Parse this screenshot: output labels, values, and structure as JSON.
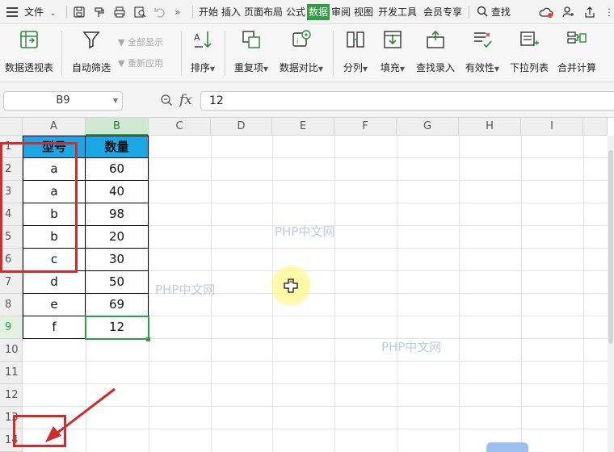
{
  "menubar": {
    "file_label": "文件",
    "tabs": [
      "开始",
      "插入",
      "页面布局",
      "公式",
      "数据",
      "审阅",
      "视图",
      "开发工具",
      "会员专享"
    ],
    "active_tab": "数据",
    "search_label": "查找"
  },
  "ribbon": {
    "pivot_label": "数据透视表",
    "autofilter_label": "自动筛选",
    "show_all_label": "全部显示",
    "reapply_label": "重新应用",
    "sort_label": "排序",
    "duplicates_label": "重复项",
    "compare_label": "数据对比",
    "split_label": "分列",
    "fill_label": "填充",
    "lookup_entry_label": "查找录入",
    "validity_label": "有效性",
    "dropdown_list_label": "下拉列表",
    "consolidate_label": "合并计算"
  },
  "formula_bar": {
    "name_box": "B9",
    "fx_label": "fx",
    "value": "12"
  },
  "sheet": {
    "columns": [
      "A",
      "B",
      "C",
      "D",
      "E",
      "F",
      "G",
      "H",
      "I"
    ],
    "rows": [
      "1",
      "2",
      "3",
      "4",
      "5",
      "6",
      "7",
      "8",
      "9",
      "10",
      "11",
      "12",
      "13",
      "14"
    ],
    "selected_column": "B",
    "selected_row": "9",
    "header_row": [
      "型号",
      "数量"
    ],
    "data": [
      [
        "a",
        "60"
      ],
      [
        "a",
        "40"
      ],
      [
        "b",
        "98"
      ],
      [
        "b",
        "20"
      ],
      [
        "c",
        "30"
      ],
      [
        "d",
        "50"
      ],
      [
        "e",
        "69"
      ],
      [
        "f",
        "12"
      ]
    ]
  },
  "watermarks": [
    "PHP中文网",
    "PHP中文网",
    "PHP中文网"
  ],
  "colors": {
    "accent_green": "#2f9e44",
    "header_fill_blue": "#1ba7e6",
    "annotation_red": "#d22b2b"
  }
}
